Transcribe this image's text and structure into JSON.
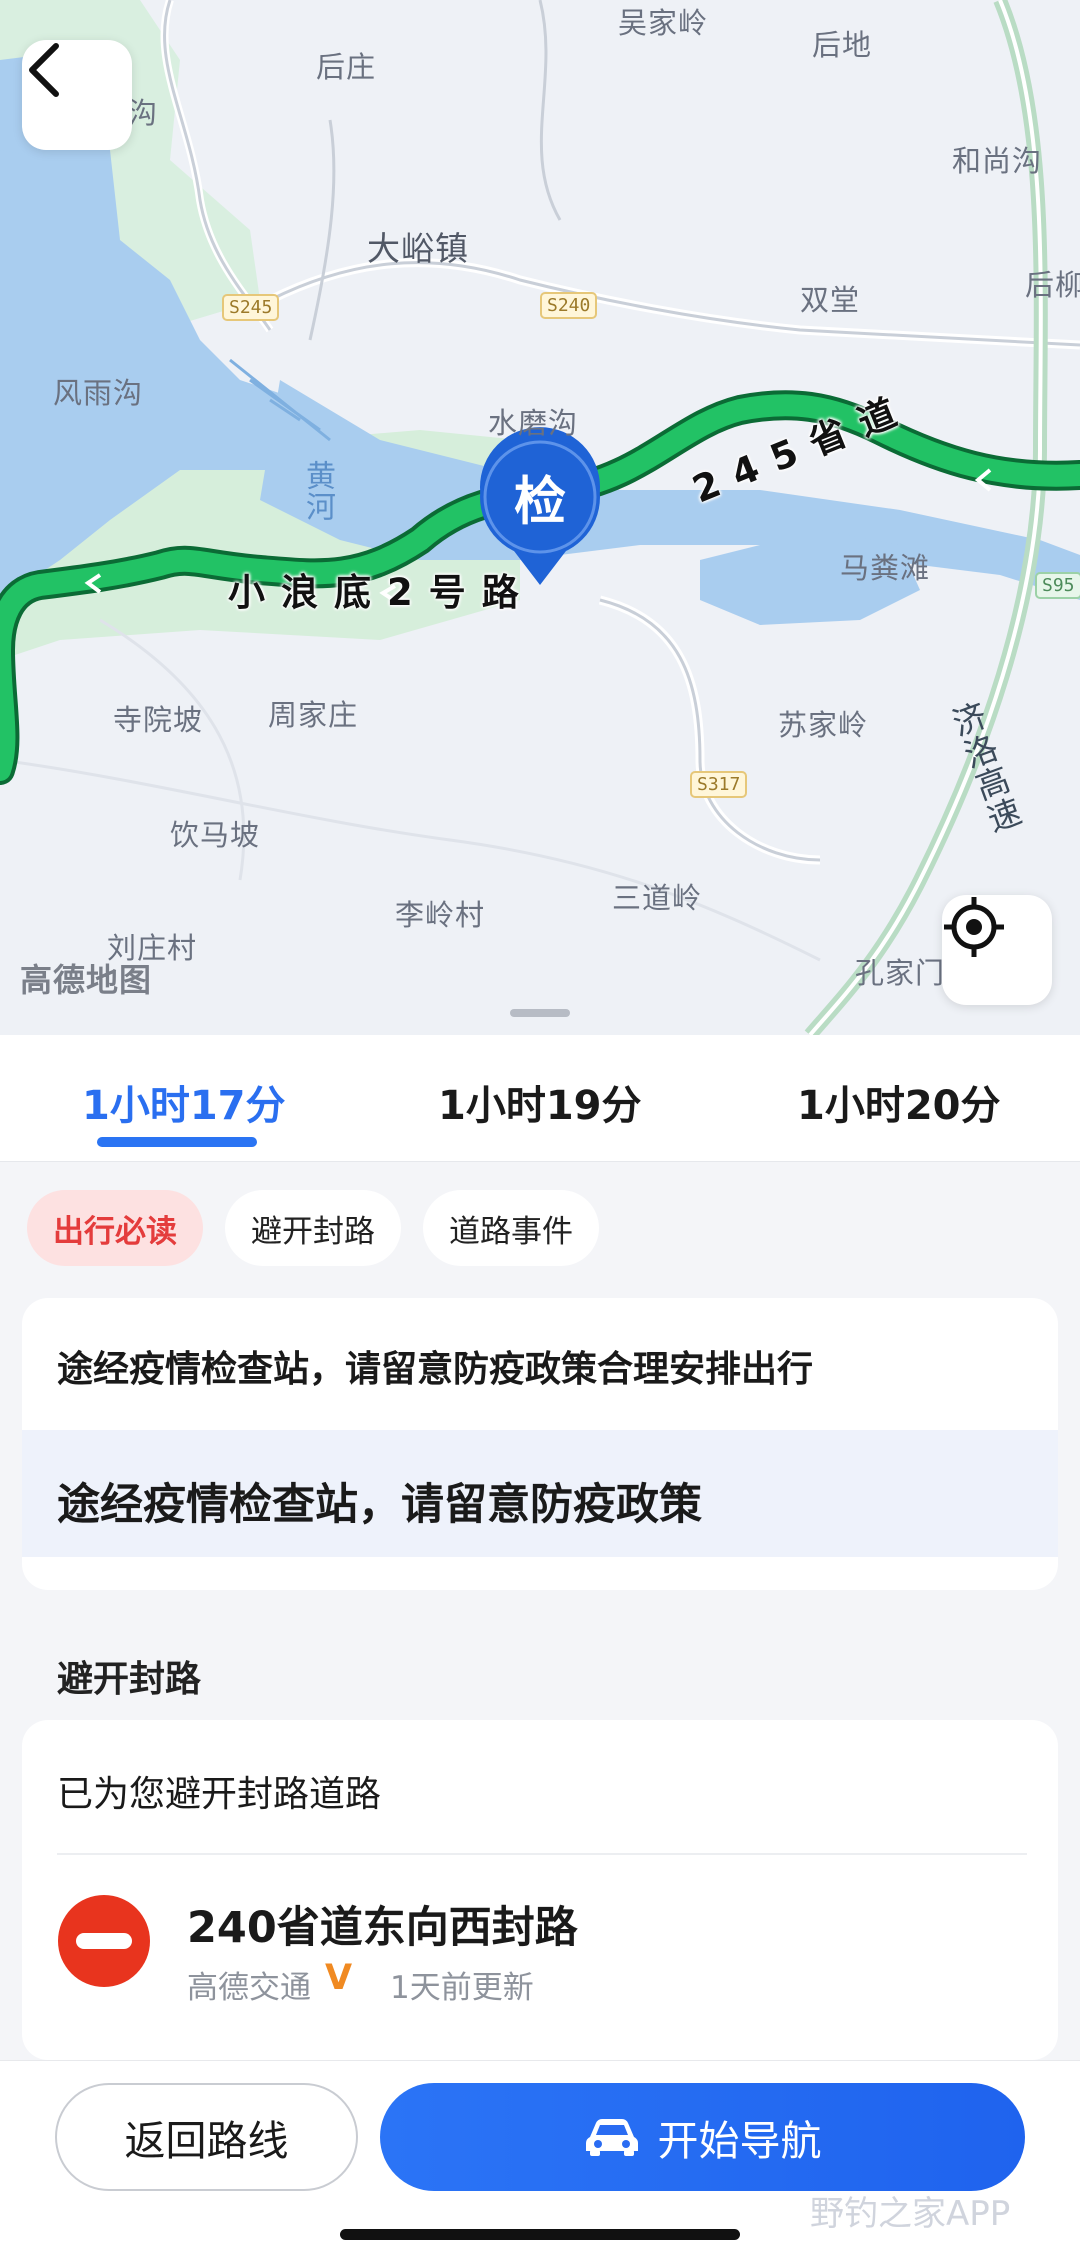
{
  "map": {
    "places": {
      "wujialing": "吴家岭",
      "houdi": "后地",
      "houzhuang": "后庄",
      "heshanggou": "和尚沟",
      "gou": "沟",
      "houliu": "后柳",
      "dayuzhen": "大峪镇",
      "shuangtang": "双堂",
      "fengyugou": "风雨沟",
      "shuimogou": "水磨沟",
      "huanghe": "黄河",
      "mafentan": "马粪滩",
      "siyuanpo": "寺院坡",
      "zhoujiazhuang": "周家庄",
      "sujialing": "苏家岭",
      "yinmapo": "饮马坡",
      "lilingcun": "李岭村",
      "sandaoling": "三道岭",
      "liuzhuangcun": "刘庄村",
      "kongjiamen": "孔家门"
    },
    "shields": {
      "s245": "S245",
      "s240": "S240",
      "s317": "S317",
      "s95": "S95"
    },
    "expressway_label": "济洛高速",
    "route_label_1": "245省道",
    "route_label_2": "小浪底2号路",
    "checkpoint_marker": "检",
    "map_logo": "高德地图"
  },
  "routes": {
    "tabs": [
      {
        "label": "1小时17分",
        "active": true
      },
      {
        "label": "1小时19分",
        "active": false
      },
      {
        "label": "1小时20分",
        "active": false
      }
    ]
  },
  "chips": [
    "出行必读",
    "避开封路",
    "道路事件"
  ],
  "notices": {
    "line1": "途经疫情检查站，请留意防疫政策合理安排出行",
    "line2": "途经疫情检查站，请留意防疫政策"
  },
  "closure": {
    "section_title": "避开封路",
    "header": "已为您避开封路道路",
    "item_title": "240省道东向西封路",
    "source": "高德交通",
    "source_badge": "V",
    "updated": "1天前更新"
  },
  "actions": {
    "return": "返回路线",
    "start": "开始导航"
  },
  "watermark": "野钓之家APP",
  "colors": {
    "accent": "#2a6ff0",
    "route_green": "#1fb55b",
    "closure_red": "#e8341e",
    "chip_red_text": "#e43c3c"
  }
}
